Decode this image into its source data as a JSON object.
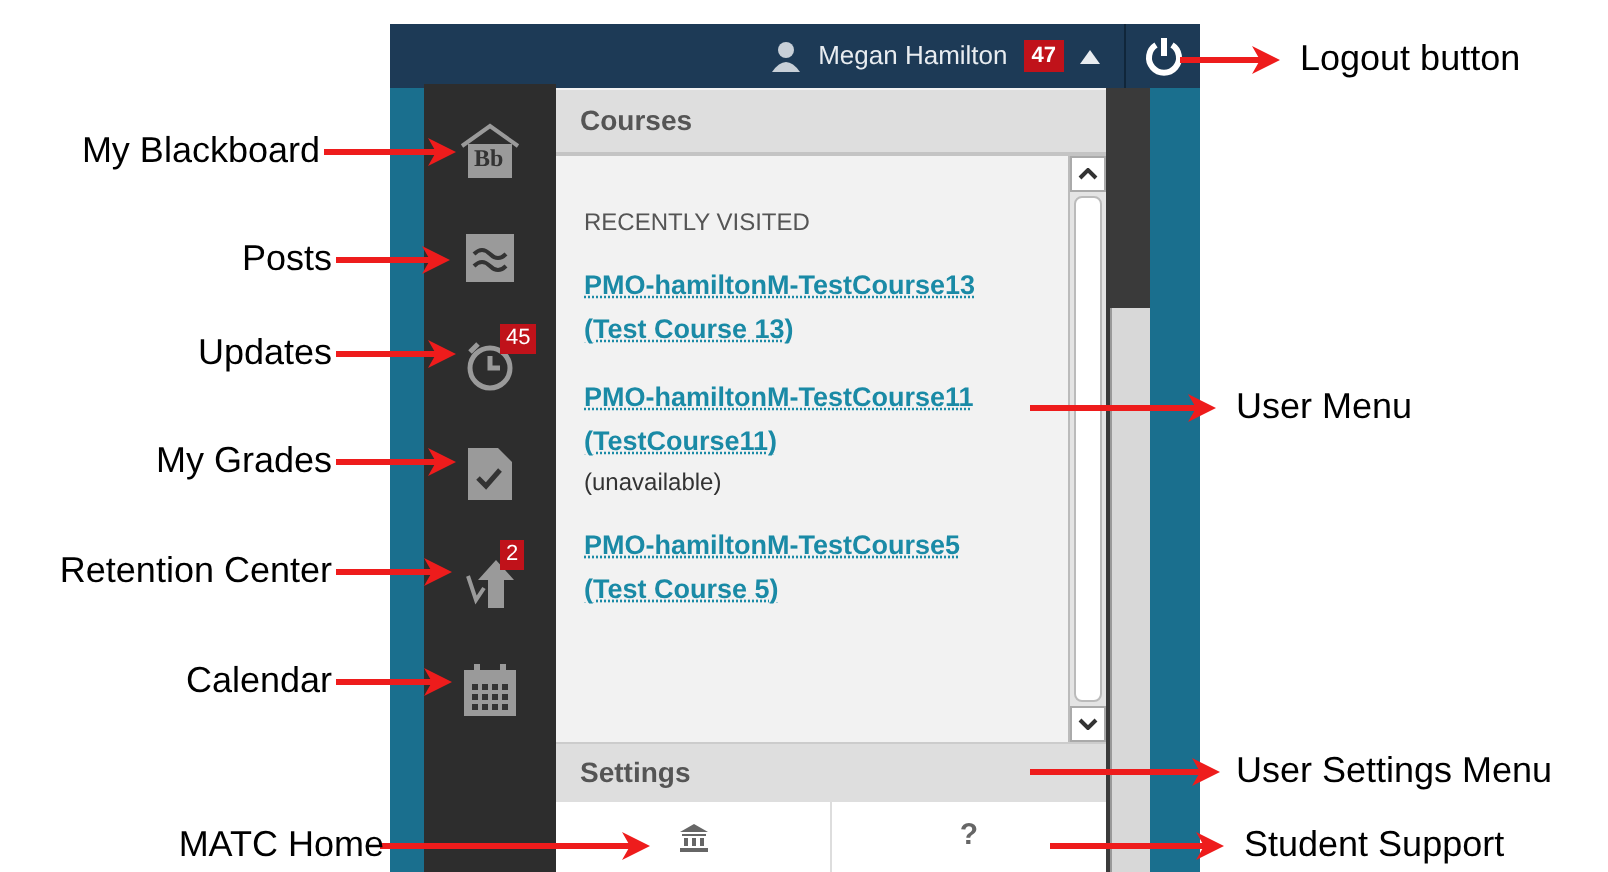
{
  "top_bar": {
    "user_name": "Megan Hamilton",
    "badge": "47"
  },
  "sidebar": {
    "items": [
      {
        "kind": "home",
        "logo_text": "Bb"
      },
      {
        "kind": "posts"
      },
      {
        "kind": "updates",
        "badge": "45"
      },
      {
        "kind": "grades"
      },
      {
        "kind": "retention",
        "badge": "2"
      },
      {
        "kind": "calendar"
      }
    ]
  },
  "courses_panel": {
    "title": "Courses",
    "section_label": "RECENTLY VISITED",
    "courses": [
      {
        "title": "PMO-hamiltonM-TestCourse13 (Test Course 13)"
      },
      {
        "title": "PMO-hamiltonM-TestCourse11 (TestCourse11)",
        "note": "(unavailable)"
      },
      {
        "title": "PMO-hamiltonM-TestCourse5 (Test Course 5)"
      }
    ]
  },
  "settings_panel": {
    "title": "Settings",
    "support_label": "?"
  },
  "annotations": [
    {
      "text": "Logout button"
    },
    {
      "text": "My Blackboard"
    },
    {
      "text": "Posts"
    },
    {
      "text": "Updates"
    },
    {
      "text": "My Grades"
    },
    {
      "text": "Retention Center"
    },
    {
      "text": "Calendar"
    },
    {
      "text": "User Menu"
    },
    {
      "text": "User Settings Menu"
    },
    {
      "text": "MATC Home"
    },
    {
      "text": "Student Support"
    }
  ]
}
